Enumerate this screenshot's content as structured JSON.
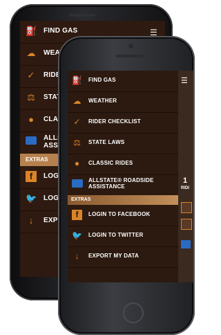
{
  "back": {
    "items": [
      {
        "label": "FIND GAS",
        "icon": "gas-pump-icon",
        "glyph": "⛽"
      },
      {
        "label": "WEATH",
        "icon": "weather-icon",
        "glyph": "☁"
      },
      {
        "label": "RIDER",
        "icon": "checklist-icon",
        "glyph": "✓"
      },
      {
        "label": "STATE",
        "icon": "state-laws-icon",
        "glyph": "⚖"
      },
      {
        "label": "CLASSI",
        "icon": "classic-rides-icon",
        "glyph": "●"
      },
      {
        "label": "ALLSTA\nASSIS",
        "icon": "allstate-icon",
        "glyph": "▮"
      }
    ],
    "extras": "EXTRAS",
    "extras_items": [
      {
        "label": "LOGIN",
        "icon": "facebook-icon",
        "glyph": "f"
      },
      {
        "label": "LOGIN",
        "icon": "twitter-icon",
        "glyph": "🐦"
      },
      {
        "label": "EXPOR",
        "icon": "export-icon",
        "glyph": "↓"
      }
    ]
  },
  "front": {
    "items": [
      {
        "label": "FIND GAS",
        "icon": "gas-pump-icon",
        "glyph": "⛽"
      },
      {
        "label": "WEATHER",
        "icon": "weather-icon",
        "glyph": "☁"
      },
      {
        "label": "RIDER CHECKLIST",
        "icon": "checklist-icon",
        "glyph": "✓"
      },
      {
        "label": "STATE LAWS",
        "icon": "state-laws-icon",
        "glyph": "⚖"
      },
      {
        "label": "CLASSIC RIDES",
        "icon": "classic-rides-icon",
        "glyph": "●"
      },
      {
        "label": "ALLSTATE® ROADSIDE\nASSISTANCE",
        "icon": "allstate-icon",
        "glyph": "▮"
      }
    ],
    "extras": "EXTRAS",
    "extras_items": [
      {
        "label": "LOGIN TO FACEBOOK",
        "icon": "facebook-icon",
        "glyph": "f"
      },
      {
        "label": "LOGIN TO TWITTER",
        "icon": "twitter-icon",
        "glyph": "🐦"
      },
      {
        "label": "EXPORT MY DATA",
        "icon": "export-icon",
        "glyph": "↓"
      }
    ],
    "right_peek_number": "1",
    "right_peek_text": "RIDI"
  },
  "colors": {
    "sidebar_bg": "#2c1a10",
    "accent": "#d9842a",
    "extras_bar": "#b6814e",
    "text": "#ffffff"
  }
}
